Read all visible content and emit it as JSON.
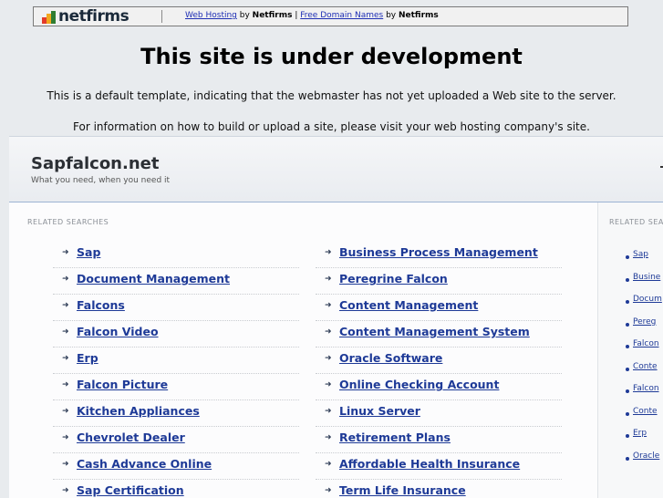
{
  "banner": {
    "logo_text": "netfirms",
    "link1": "Web Hosting",
    "by1": " by ",
    "brand1": "Netfirms",
    "sep": " | ",
    "link2": "Free Domain Names",
    "by2": " by ",
    "brand2": "Netfirms"
  },
  "notice": {
    "title": "This site is under development",
    "line1": "This is a default template, indicating that the webmaster has not yet uploaded a Web site to the server.",
    "line2": "For information on how to build or upload a site, please visit your web hosting company's site."
  },
  "site": {
    "name": "Sapfalcon.net",
    "tagline": "What you need, when you need it"
  },
  "related": {
    "label": "RELATED SEARCHES",
    "left": [
      "Sap",
      "Document Management",
      "Falcons",
      "Falcon Video",
      "Erp",
      "Falcon Picture",
      "Kitchen Appliances",
      "Chevrolet Dealer",
      "Cash Advance Online",
      "Sap Certification"
    ],
    "right": [
      "Business Process Management",
      "Peregrine Falcon",
      "Content Management",
      "Content Management System",
      "Oracle Software",
      "Online Checking Account",
      "Linux Server",
      "Retirement Plans",
      "Affordable Health Insurance",
      "Term Life Insurance"
    ]
  },
  "sidebar": {
    "label": "RELATED SEA",
    "items": [
      "Sap",
      "Busine",
      "Docum",
      "Pereg",
      "Falcon",
      "Conte",
      "Falcon",
      "Conte",
      "Erp",
      "Oracle"
    ]
  },
  "colors": {
    "link": "#1e3a97",
    "accent_border": "#9cb3d3"
  }
}
